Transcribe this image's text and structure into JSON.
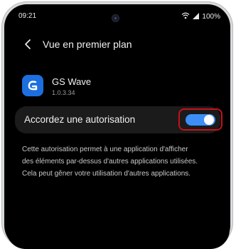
{
  "status_bar": {
    "time": "09:21",
    "battery": "100%",
    "icons": [
      "wifi-icon",
      "signal-icon"
    ]
  },
  "header": {
    "back_icon": "chevron-left-icon",
    "title": "Vue en premier plan"
  },
  "app": {
    "name": "GS Wave",
    "version": "1.0.3.34",
    "icon_color": "#1d6fe0"
  },
  "permission": {
    "label": "Accordez une autorisation",
    "enabled": true,
    "toggle_color": "#3e8ef7",
    "highlight_color": "#c8101a"
  },
  "description": {
    "lines": [
      "Cette autorisation permet à une application d'afficher",
      "des éléments par-dessus d'autres applications utilisées.",
      "Cela peut gêner votre utilisation d'autres applications."
    ]
  }
}
